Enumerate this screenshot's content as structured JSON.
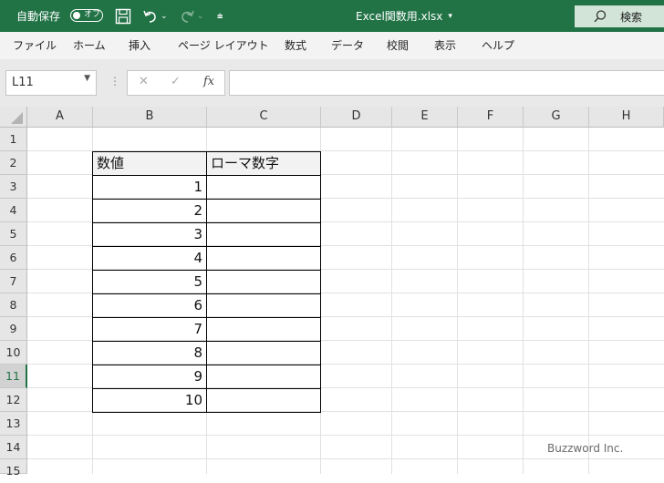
{
  "titlebar": {
    "autosave_label": "自動保存",
    "autosave_state": "オフ",
    "file_name": "Excel関数用.xlsx",
    "search_label": "検索",
    "bg_color": "#217346"
  },
  "ribbon": {
    "tabs": [
      "ファイル",
      "ホーム",
      "挿入",
      "ページ レイアウト",
      "数式",
      "データ",
      "校閲",
      "表示",
      "ヘルプ"
    ]
  },
  "formula_bar": {
    "name_box": "L11",
    "cancel_symbol": "✕",
    "enter_symbol": "✓",
    "fx_symbol": "fx",
    "content": ""
  },
  "sheet": {
    "columns": [
      "A",
      "B",
      "C",
      "D",
      "E",
      "F",
      "G",
      "H"
    ],
    "rows": [
      "1",
      "2",
      "3",
      "4",
      "5",
      "6",
      "7",
      "8",
      "9",
      "10",
      "11",
      "12",
      "13",
      "14",
      "15"
    ],
    "selected_row": "11",
    "table": {
      "headers": [
        "数値",
        "ローマ数字"
      ],
      "values": [
        "1",
        "2",
        "3",
        "4",
        "5",
        "6",
        "7",
        "8",
        "9",
        "10"
      ]
    }
  },
  "watermark": "Buzzword Inc."
}
